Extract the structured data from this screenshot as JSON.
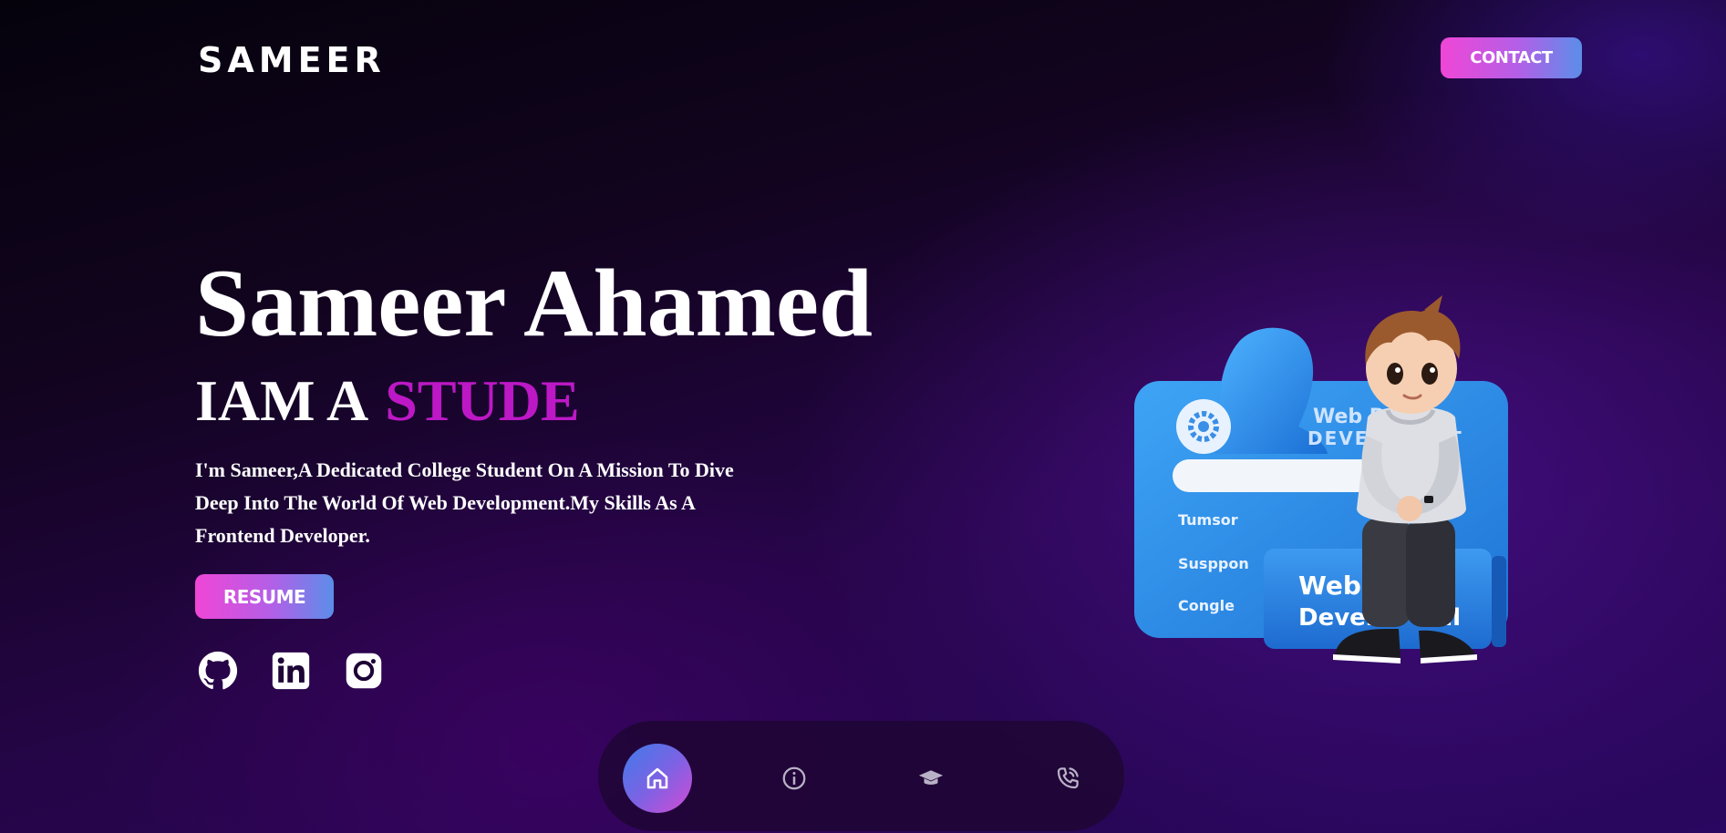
{
  "header": {
    "logo_text": "SAMEER",
    "contact_label": "CONTACT"
  },
  "hero": {
    "name": "Sameer Ahamed",
    "role_prefix": "IAM A",
    "role_typed": "STUDE",
    "description": "I'm Sameer,A Dedicated College Student On A Mission To Dive Deep Into The World Of Web Development.My Skills As A Frontend Developer.",
    "resume_label": "RESUME"
  },
  "socials": [
    {
      "name": "github",
      "icon": "github-icon"
    },
    {
      "name": "linkedin",
      "icon": "linkedin-icon"
    },
    {
      "name": "instagram",
      "icon": "instagram-icon"
    }
  ],
  "illustration": {
    "card_title_1": "Web De",
    "card_title_2": "DEVELO",
    "card_title_3": "T",
    "menu_items": [
      "Tumsor",
      "Susppon",
      "Congle"
    ],
    "panel_text_1": "Web",
    "panel_text_2": "Develo",
    "panel_text_3": "ml"
  },
  "bottom_nav": {
    "items": [
      {
        "name": "home",
        "icon": "home-icon",
        "active": true
      },
      {
        "name": "about",
        "icon": "info-icon",
        "active": false
      },
      {
        "name": "education",
        "icon": "graduation-cap-icon",
        "active": false
      },
      {
        "name": "contact",
        "icon": "phone-icon",
        "active": false
      }
    ]
  },
  "colors": {
    "accent_pink": "#f046d6",
    "accent_blue": "#5b8ee8",
    "typed_text": "#bd18c6",
    "background_dark": "#12041f",
    "background_purple": "#2a0760"
  }
}
